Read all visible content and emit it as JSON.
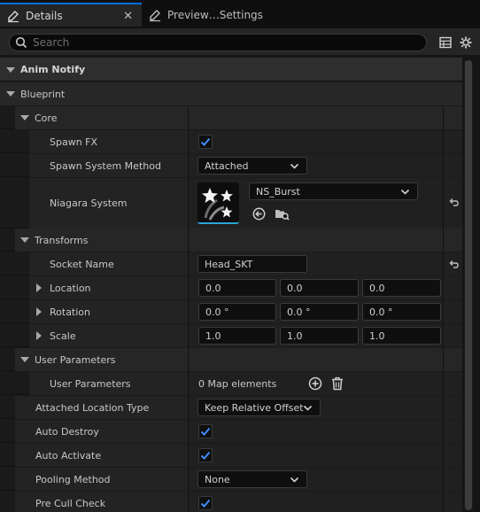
{
  "tabs": [
    {
      "label": "Details",
      "icon": "pencil-icon"
    },
    {
      "label": "Preview…Settings",
      "icon": "pencil-icon"
    }
  ],
  "search": {
    "placeholder": "Search"
  },
  "toolbar": {
    "table_view_icon": "table-icon",
    "settings_icon": "gear-icon"
  },
  "categories": {
    "anim_notify": "Anim Notify",
    "blueprint": "Blueprint",
    "core": "Core",
    "transforms": "Transforms",
    "user_parameters": "User Parameters"
  },
  "properties": {
    "spawn_fx": {
      "label": "Spawn FX",
      "checked": true
    },
    "spawn_system_method": {
      "label": "Spawn System Method",
      "value": "Attached"
    },
    "niagara_system": {
      "label": "Niagara System",
      "value": "NS_Burst",
      "thumbnail_icon": "stars-icon"
    },
    "socket_name": {
      "label": "Socket Name",
      "value": "Head_SKT"
    },
    "location": {
      "label": "Location",
      "x": "0.0",
      "y": "0.0",
      "z": "0.0"
    },
    "rotation": {
      "label": "Rotation",
      "x": "0.0 °",
      "y": "0.0 °",
      "z": "0.0 °"
    },
    "scale": {
      "label": "Scale",
      "x": "1.0",
      "y": "1.0",
      "z": "1.0"
    },
    "user_parameters": {
      "label": "User Parameters",
      "value": "0 Map elements"
    },
    "attached_location_type": {
      "label": "Attached Location Type",
      "value": "Keep Relative Offset"
    },
    "auto_destroy": {
      "label": "Auto Destroy",
      "checked": true
    },
    "auto_activate": {
      "label": "Auto Activate",
      "checked": true
    },
    "pooling_method": {
      "label": "Pooling Method",
      "value": "None"
    },
    "pre_cull_check": {
      "label": "Pre Cull Check",
      "checked": true
    }
  },
  "colors": {
    "accent": "#0070e0",
    "check": "#3d8bf5",
    "panel": "#1a1a1a"
  }
}
